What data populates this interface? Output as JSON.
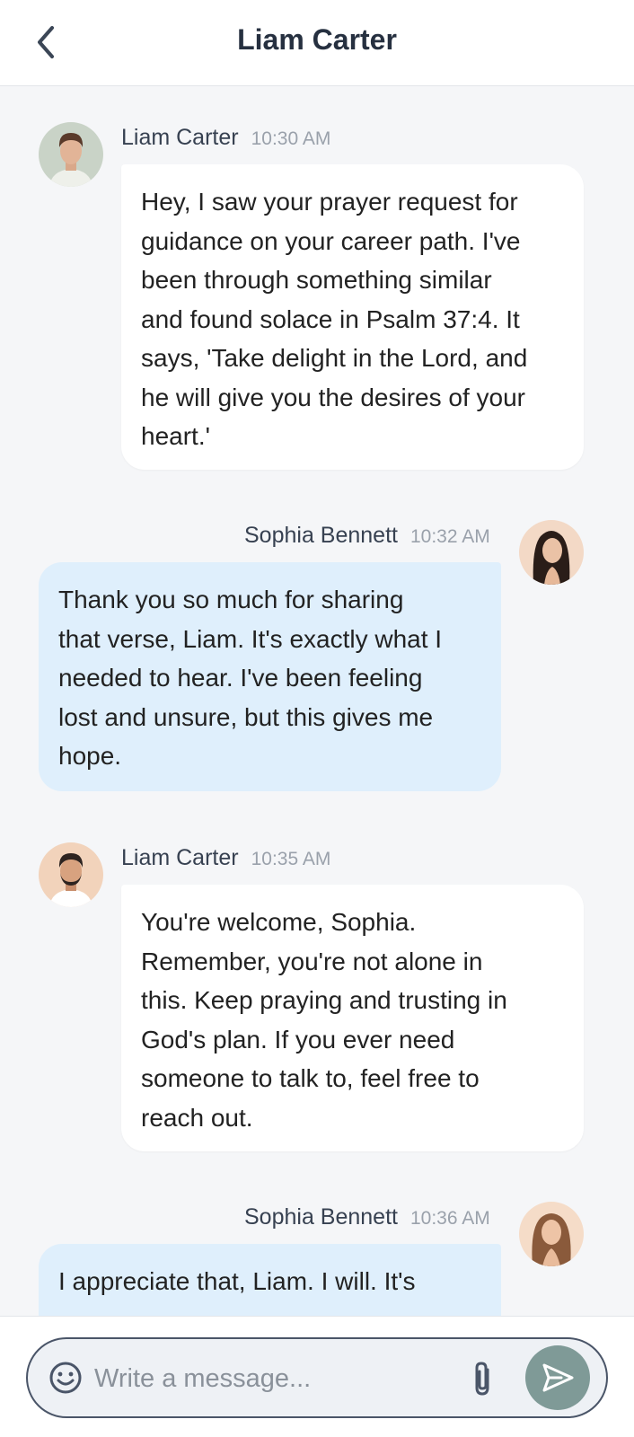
{
  "header": {
    "title": "Liam Carter",
    "back_icon": "chevron-left-icon"
  },
  "messages": [
    {
      "sender": "Liam Carter",
      "time": "10:30 AM",
      "direction": "incoming",
      "text": "Hey, I saw your prayer request for\nguidance on your career path. I've\nbeen through something similar\nand found solace in Psalm 37:4. It\nsays, 'Take delight in the Lord, and\nhe will give you the desires of your\nheart.'"
    },
    {
      "sender": "Sophia Bennett",
      "time": "10:32 AM",
      "direction": "outgoing",
      "text": "Thank you so much for sharing\nthat verse, Liam. It's exactly what I\nneeded to hear. I've been feeling\nlost and unsure, but this gives me\nhope."
    },
    {
      "sender": "Liam Carter",
      "time": "10:35 AM",
      "direction": "incoming",
      "text": "You're welcome, Sophia.\nRemember, you're not alone in\nthis. Keep praying and trusting in\nGod's plan. If you ever need\nsomeone to talk to, feel free to\nreach out."
    },
    {
      "sender": "Sophia Bennett",
      "time": "10:36 AM",
      "direction": "outgoing",
      "text": "I appreciate that, Liam. I will. It's"
    }
  ],
  "composer": {
    "placeholder": "Write a message...",
    "emoji_icon": "emoji-icon",
    "attach_icon": "paperclip-icon",
    "send_icon": "send-icon"
  },
  "colors": {
    "incoming_bubble": "#ffffff",
    "outgoing_bubble": "#dfeffc",
    "send_button": "#7f9a97",
    "background": "#f5f6f8"
  }
}
